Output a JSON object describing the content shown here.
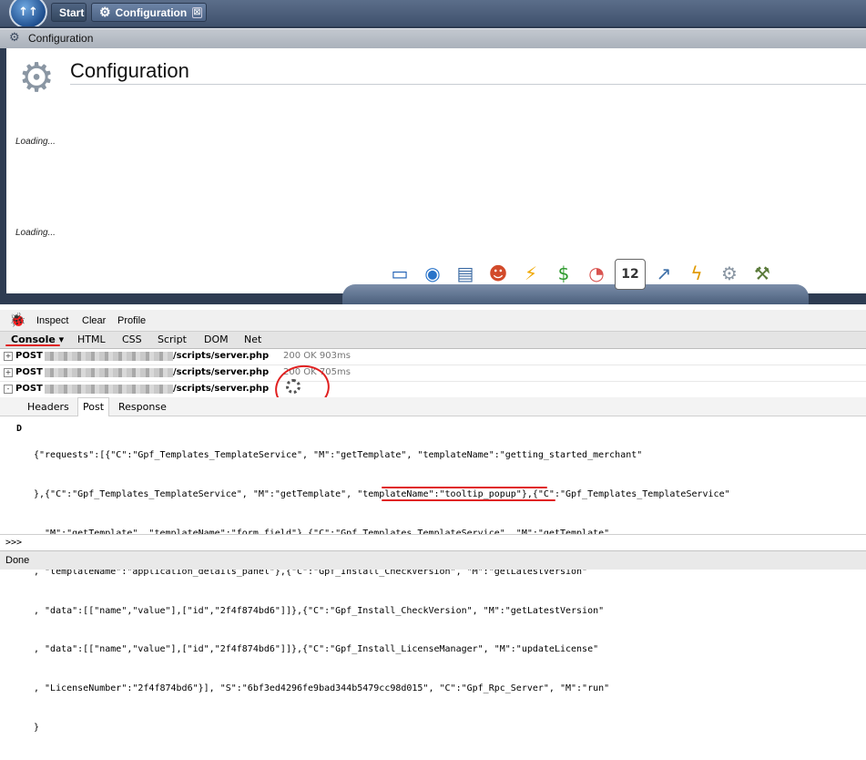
{
  "app": {
    "tabs": [
      {
        "label": "Start"
      },
      {
        "label": "Configuration",
        "close": "⊠"
      }
    ],
    "window_title": "Configuration",
    "page_heading": "Configuration",
    "loading_labels": [
      "Loading...",
      "Loading..."
    ]
  },
  "dock_icons": [
    {
      "name": "monitor-icon",
      "glyph": "▭",
      "color": "#1e5fb4"
    },
    {
      "name": "globe-user-icon",
      "glyph": "◉",
      "color": "#2a74c9"
    },
    {
      "name": "window-user-icon",
      "glyph": "▤",
      "color": "#3b6aa3"
    },
    {
      "name": "users-icon",
      "glyph": "☻",
      "color": "#d24a2a"
    },
    {
      "name": "lightning-icon",
      "glyph": "⚡",
      "color": "#f0a800"
    },
    {
      "name": "money-user-icon",
      "glyph": "$",
      "color": "#2e9a2e"
    },
    {
      "name": "pie-chart-icon",
      "glyph": "◔",
      "color": "#d9534f"
    },
    {
      "name": "calendar-icon",
      "glyph": "12",
      "color": "#333333"
    },
    {
      "name": "chart-globe-icon",
      "glyph": "↗",
      "color": "#3d6fa8"
    },
    {
      "name": "lightning-doc-icon",
      "glyph": "ϟ",
      "color": "#e09a00"
    },
    {
      "name": "gear-icon",
      "glyph": "⚙",
      "color": "#8a96a3"
    },
    {
      "name": "tools-icon",
      "glyph": "⚒",
      "color": "#5a7a3a"
    }
  ],
  "firebug": {
    "toolbar": {
      "inspect": "Inspect",
      "clear": "Clear",
      "profile": "Profile"
    },
    "tabs": {
      "console": "Console",
      "html": "HTML",
      "css": "CSS",
      "script": "Script",
      "dom": "DOM",
      "net": "Net"
    },
    "requests": [
      {
        "toggle": "+",
        "method": "POST",
        "path": "/scripts/server.php",
        "status": "200 OK 903ms"
      },
      {
        "toggle": "+",
        "method": "POST",
        "path": "/scripts/server.php",
        "status": "200 OK 705ms"
      },
      {
        "toggle": "-",
        "method": "POST",
        "path": "/scripts/server.php",
        "status": ""
      }
    ],
    "detail_tabs": {
      "headers": "Headers",
      "post": "Post",
      "response": "Response"
    },
    "post_label": "D",
    "post_lines": [
      "{\"requests\":[{\"C\":\"Gpf_Templates_TemplateService\", \"M\":\"getTemplate\", \"templateName\":\"getting_started_merchant\"",
      "},{\"C\":\"Gpf_Templates_TemplateService\", \"M\":\"getTemplate\", \"templateName\":\"tooltip_popup\"},{\"C\":\"Gpf_Templates_TemplateService\"",
      ", \"M\":\"getTemplate\", \"templateName\":\"form_field\"},{\"C\":\"Gpf_Templates_TemplateService\", \"M\":\"getTemplate\"",
      ", \"templateName\":\"application_details_panel\"},{\"C\":\"Gpf_Install_CheckVersion\", \"M\":\"getLatestVersion\"",
      ", \"data\":[[\"name\",\"value\"],[\"id\",\"2f4f874bd6\"]]},{\"C\":\"Gpf_Install_CheckVersion\", \"M\":\"getLatestVersion\"",
      ", \"data\":[[\"name\",\"value\"],[\"id\",\"2f4f874bd6\"]]},{\"C\":\"Gpf_Install_LicenseManager\", \"M\":\"updateLicense\"",
      ", \"LicenseNumber\":\"2f4f874bd6\"}], \"S\":\"6bf3ed4296fe9bad344b5479cc98d015\", \"C\":\"Gpf_Rpc_Server\", \"M\":\"run\"",
      "}"
    ],
    "command_prompt": ">>>",
    "status": "Done"
  },
  "annotation_color": "#e02020"
}
